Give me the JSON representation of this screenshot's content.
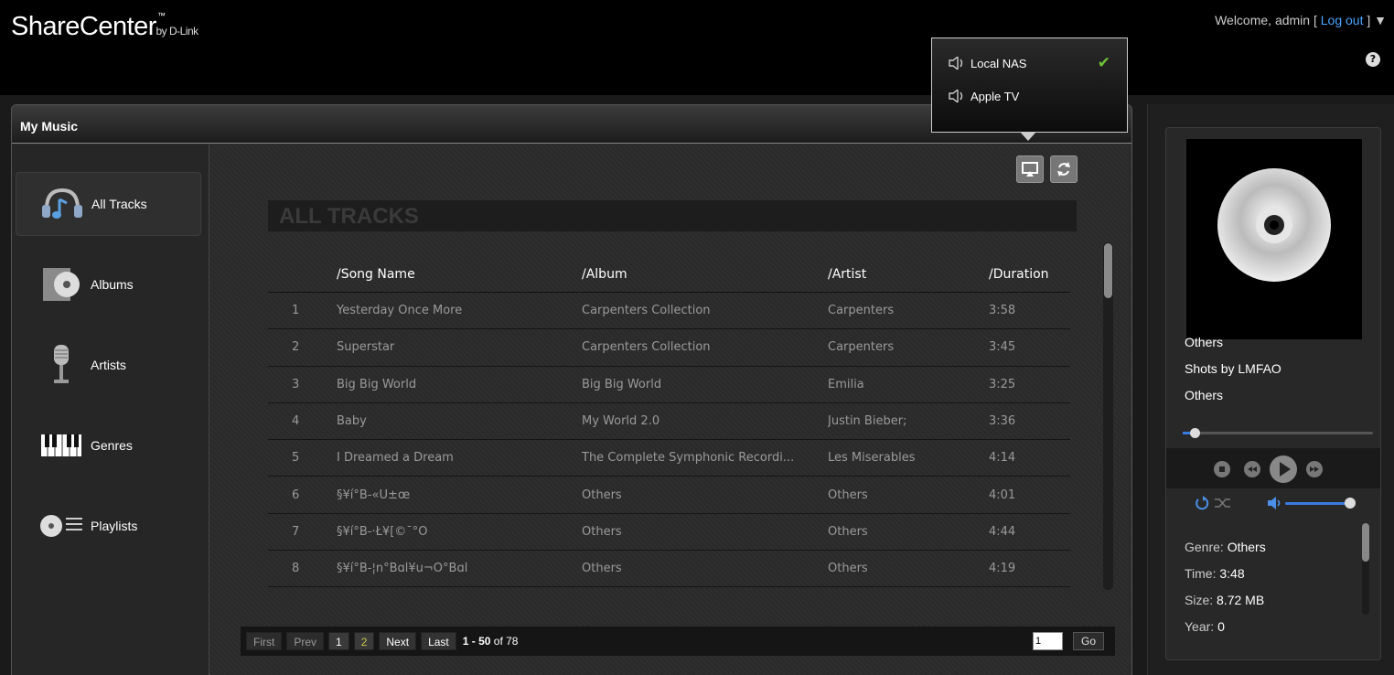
{
  "header": {
    "logo_main": "ShareCenter",
    "logo_tm": "™",
    "logo_by": "by D-Link",
    "welcome_prefix": "Welcome, admin [",
    "logout_label": "Log out",
    "welcome_suffix": "] ▼",
    "help_label": "?"
  },
  "panel": {
    "title": "My Music"
  },
  "nav": {
    "items": [
      {
        "label": "All Tracks",
        "icon": "headphones-icon"
      },
      {
        "label": "Albums",
        "icon": "album-icon"
      },
      {
        "label": "Artists",
        "icon": "microphone-icon"
      },
      {
        "label": "Genres",
        "icon": "piano-keys-icon"
      },
      {
        "label": "Playlists",
        "icon": "playlist-icon"
      }
    ]
  },
  "content": {
    "section_title": "ALL TRACKS",
    "columns": [
      "/Song Name",
      "/Album",
      "/Artist",
      "/Duration"
    ],
    "tracks": [
      {
        "num": "1",
        "song": "Yesterday Once More",
        "album": "Carpenters Collection",
        "artist": "Carpenters",
        "duration": "3:58"
      },
      {
        "num": "2",
        "song": "Superstar",
        "album": "Carpenters Collection",
        "artist": "Carpenters",
        "duration": "3:45"
      },
      {
        "num": "3",
        "song": "Big Big World",
        "album": "Big Big World",
        "artist": "Emilia",
        "duration": "3:25"
      },
      {
        "num": "4",
        "song": "Baby",
        "album": "My World 2.0",
        "artist": "Justin Bieber;",
        "duration": "3:36"
      },
      {
        "num": "5",
        "song": "I Dreamed a Dream",
        "album": "The Complete Symphonic Recordi...",
        "artist": "Les Miserables",
        "duration": "4:14"
      },
      {
        "num": "6",
        "song": "§¥í°B-«Ü±œ",
        "album": "Others",
        "artist": "Others",
        "duration": "4:01"
      },
      {
        "num": "7",
        "song": "§¥í°B-·Ł¥[©¯°Ö",
        "album": "Others",
        "artist": "Others",
        "duration": "4:44"
      },
      {
        "num": "8",
        "song": "§¥í°B-¦n°Bɑĺ¥u¬O°Bɑĺ",
        "album": "Others",
        "artist": "Others",
        "duration": "4:19"
      }
    ]
  },
  "pager": {
    "first": "First",
    "prev": "Prev",
    "page1": "1",
    "page2": "2",
    "next": "Next",
    "last": "Last",
    "range": "1 - 50",
    "of_text": " of 78",
    "page_input": "1",
    "go": "Go"
  },
  "airplay_popup": {
    "items": [
      {
        "label": "Local NAS",
        "selected": true
      },
      {
        "label": "Apple TV",
        "selected": false
      }
    ],
    "check": "✔"
  },
  "player": {
    "line1": "Others",
    "line2": "Shots by LMFAO",
    "line3": "Others",
    "progress_fraction": 0.04,
    "volume_fraction": 0.85,
    "genre_label": "Genre:",
    "genre_value": "Others",
    "time_label": "Time:",
    "time_value": "3:48",
    "size_label": "Size:",
    "size_value": "8.72 MB",
    "year_label": "Year:",
    "year_value": "0"
  },
  "colors": {
    "link": "#4aa3ff",
    "accent": "#3a7be0",
    "check": "#6fc13a",
    "current_page": "#c8c84a"
  }
}
